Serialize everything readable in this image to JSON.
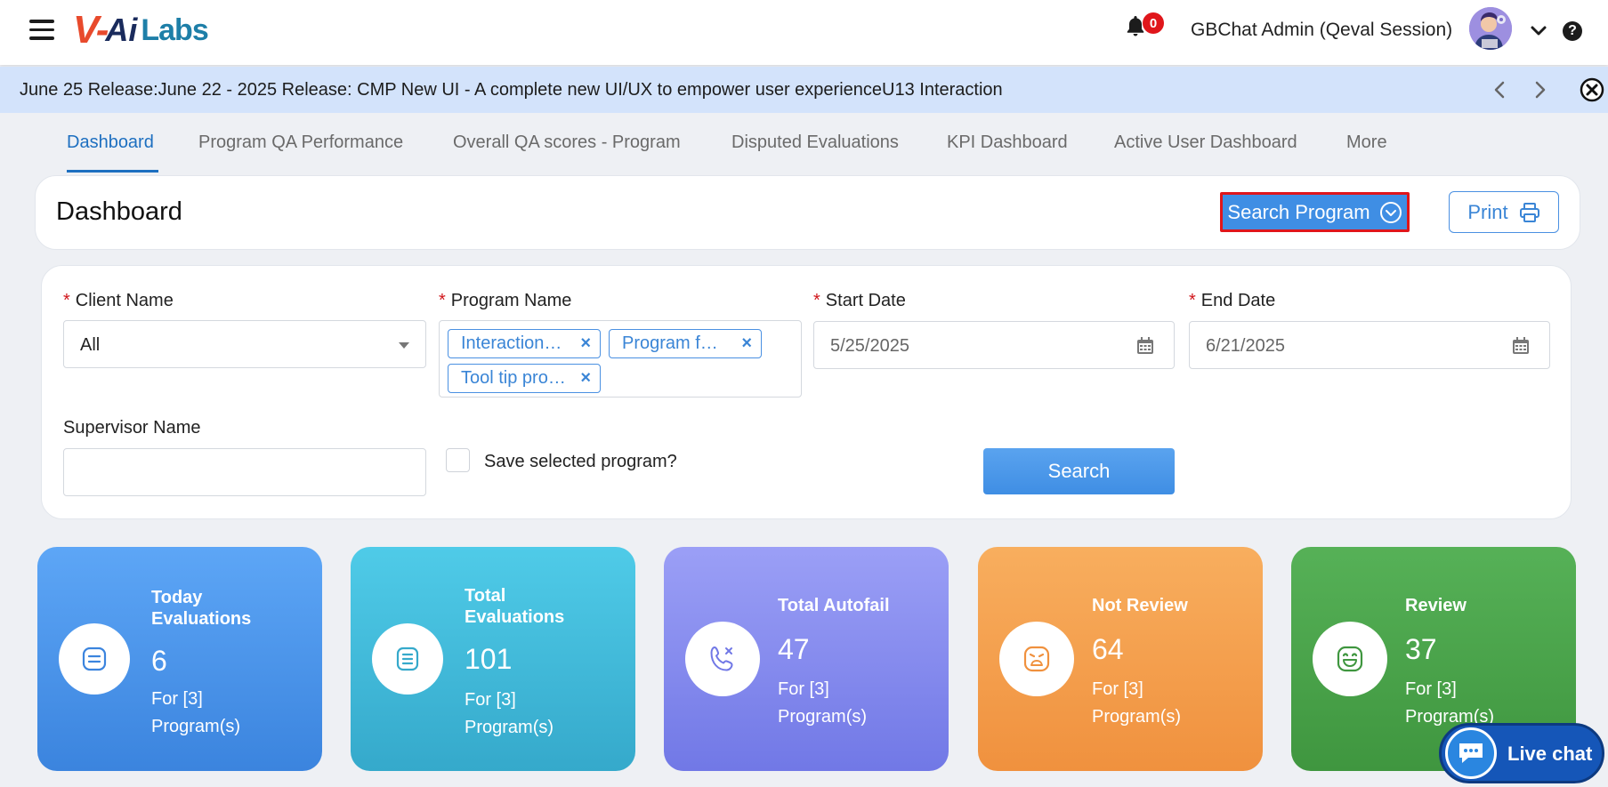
{
  "header": {
    "logo": {
      "part1": "V-",
      "part2": "Ai",
      "part3": "Labs"
    },
    "notification_count": "0",
    "user_name": "GBChat Admin (Qeval Session)"
  },
  "ticker": {
    "text": "June 25 Release:June 22 - 2025 Release: CMP New UI - A complete new UI/UX to empower user experienceU13 Interaction"
  },
  "tabs": [
    {
      "label": "Dashboard",
      "active": true
    },
    {
      "label": "Program QA Performance"
    },
    {
      "label": "Overall QA scores - Program"
    },
    {
      "label": "Disputed Evaluations"
    },
    {
      "label": "KPI Dashboard"
    },
    {
      "label": "Active User Dashboard"
    },
    {
      "label": "More"
    }
  ],
  "title_card": {
    "title": "Dashboard",
    "search_program_label": "Search Program",
    "print_label": "Print"
  },
  "filters": {
    "client_name": {
      "label": "Client Name",
      "value": "All"
    },
    "program_name": {
      "label": "Program Name",
      "tags": [
        "Interaction…",
        "Program f…",
        "Tool tip pro…"
      ]
    },
    "start_date": {
      "label": "Start Date",
      "value": "5/25/2025"
    },
    "end_date": {
      "label": "End Date",
      "value": "6/21/2025"
    },
    "supervisor_name": {
      "label": "Supervisor Name",
      "value": ""
    },
    "save_selected": {
      "label": "Save selected program?",
      "checked": false
    },
    "search_label": "Search",
    "required_mark": "*"
  },
  "stats": [
    {
      "title_line1": "Today",
      "title_line2": "Evaluations",
      "value": "6",
      "sub_line1": "For [3]",
      "sub_line2": "Program(s)",
      "colors": [
        "#5da6f6",
        "#3b84de"
      ]
    },
    {
      "title_line1": "Total",
      "title_line2": "Evaluations",
      "value": "101",
      "sub_line1": "For [3]",
      "sub_line2": "Program(s)",
      "colors": [
        "#4fcbe8",
        "#35a9cb"
      ]
    },
    {
      "title_line1": "Total Autofail",
      "title_line2": "",
      "value": "47",
      "sub_line1": "For [3]",
      "sub_line2": "Program(s)",
      "colors": [
        "#9b9ff6",
        "#7178e6"
      ]
    },
    {
      "title_line1": "Not Review",
      "title_line2": "",
      "value": "64",
      "sub_line1": "For [3]",
      "sub_line2": "Program(s)",
      "colors": [
        "#f8ae5e",
        "#f0913e"
      ]
    },
    {
      "title_line1": "Review",
      "title_line2": "",
      "value": "37",
      "sub_line1": "For [3]",
      "sub_line2": "Program(s)",
      "colors": [
        "#56b157",
        "#3f963f"
      ]
    }
  ],
  "live_chat": {
    "label": "Live chat"
  }
}
